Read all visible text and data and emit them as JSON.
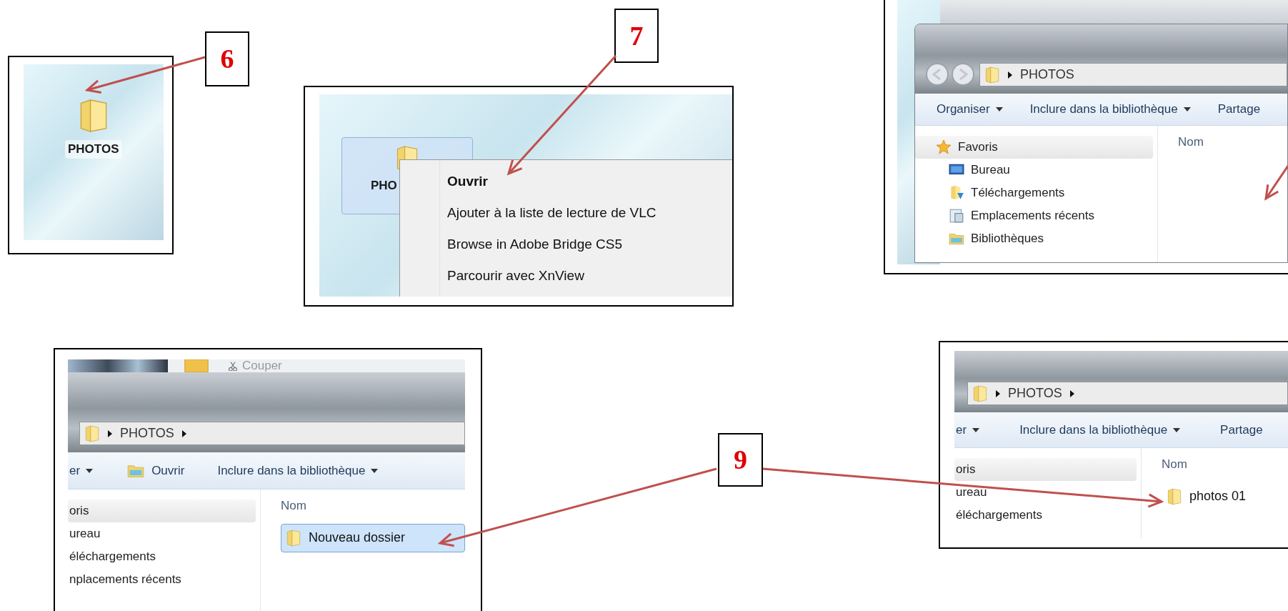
{
  "callouts": [
    {
      "label": "6"
    },
    {
      "label": "7"
    },
    {
      "label": "9"
    }
  ],
  "desktop_icon": {
    "label": "PHOTOS"
  },
  "context_menu": {
    "icon_label": "PHO",
    "items": [
      {
        "label": "Ouvrir",
        "default": true
      },
      {
        "label": "Ajouter à la liste de lecture de VLC",
        "default": false
      },
      {
        "label": "Browse in Adobe Bridge CS5",
        "default": false
      },
      {
        "label": "Parcourir avec XnView",
        "default": false
      }
    ]
  },
  "explorer_open": {
    "address": "PHOTOS",
    "trailing_chevron": false,
    "toolbar": [
      {
        "label": "Organiser",
        "dropdown": true,
        "has_icon": false
      },
      {
        "label": "Inclure dans la bibliothèque",
        "dropdown": true,
        "has_icon": false
      },
      {
        "label": "Partage",
        "dropdown": false,
        "has_icon": false
      }
    ],
    "sidebar": [
      {
        "label": "Favoris",
        "kind": "favorites",
        "children": [
          {
            "label": "Bureau",
            "kind": "desktop"
          },
          {
            "label": "Téléchargements",
            "kind": "downloads"
          },
          {
            "label": "Emplacements récents",
            "kind": "recent"
          }
        ]
      },
      {
        "label": "Bibliothèques",
        "kind": "libraries"
      }
    ],
    "column": "Nom"
  },
  "explorer_new_folder": {
    "ribbon_label": "Couper",
    "address": "PHOTOS",
    "trailing_chevron": true,
    "toolbar": [
      {
        "label": "er",
        "dropdown": true,
        "has_icon": false
      },
      {
        "label": "Ouvrir",
        "dropdown": false,
        "has_icon": true
      },
      {
        "label": "Inclure dans la bibliothèque",
        "dropdown": true,
        "has_icon": false
      }
    ],
    "sidebar": [
      {
        "label": "oris",
        "children": [
          {
            "label": "ureau"
          },
          {
            "label": "éléchargements"
          },
          {
            "label": "nplacements récents"
          }
        ]
      }
    ],
    "column": "Nom",
    "files": [
      {
        "label": "Nouveau dossier",
        "selected": true
      }
    ]
  },
  "explorer_renamed": {
    "address": "PHOTOS",
    "trailing_chevron": true,
    "toolbar": [
      {
        "label": "er",
        "dropdown": true,
        "has_icon": false
      },
      {
        "label": "Inclure dans la bibliothèque",
        "dropdown": true,
        "has_icon": false
      },
      {
        "label": "Partage",
        "dropdown": false,
        "has_icon": false
      }
    ],
    "sidebar": [
      {
        "label": "oris",
        "children": [
          {
            "label": "ureau"
          },
          {
            "label": "éléchargements"
          }
        ]
      }
    ],
    "column": "Nom",
    "files": [
      {
        "label": "photos 01",
        "selected": false
      }
    ]
  }
}
